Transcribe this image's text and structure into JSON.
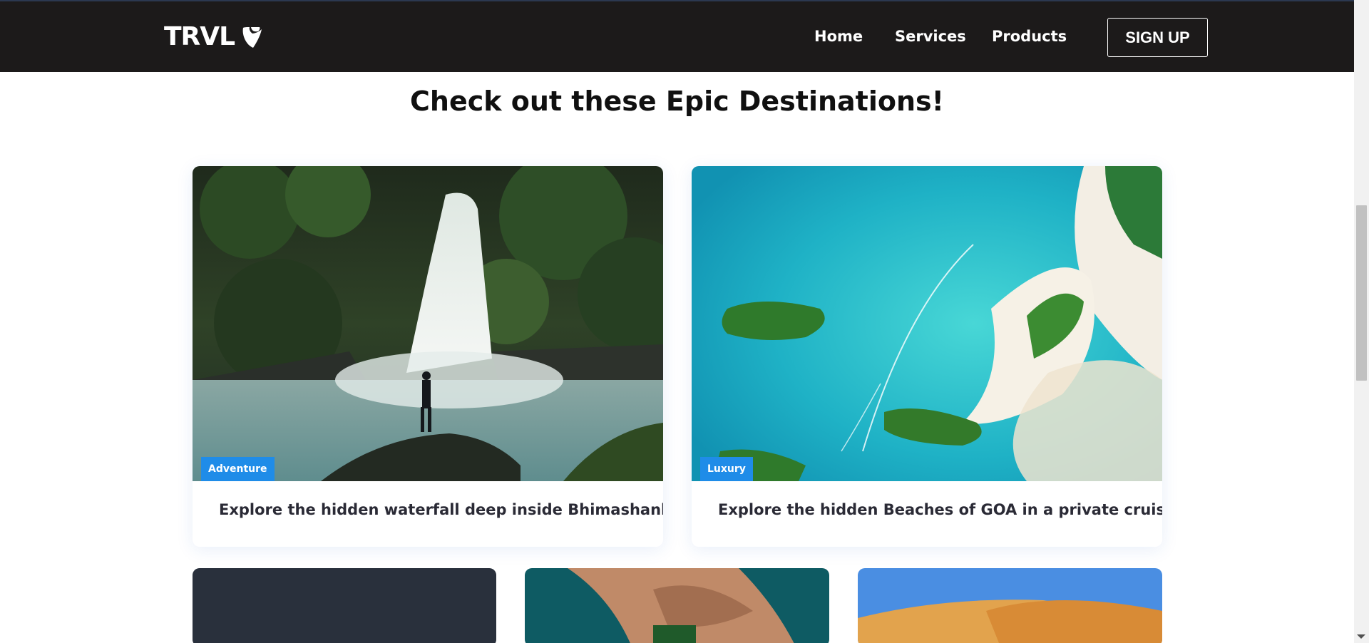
{
  "navbar": {
    "logo_text": "TRVL",
    "links": [
      {
        "label": "Home"
      },
      {
        "label": "Services"
      },
      {
        "label": "Products"
      }
    ],
    "signup_label": "SIGN UP"
  },
  "main": {
    "heading": "Check out these Epic Destinations!",
    "cards": [
      {
        "badge": "Adventure",
        "title": "Explore the hidden waterfall deep inside Bhimashankar",
        "image": "waterfall-image"
      },
      {
        "badge": "Luxury",
        "title": "Explore the hidden Beaches of GOA in a private cruise",
        "image": "beach-aerial-image"
      }
    ],
    "more_cards": [
      {
        "image": "dark-sea-image"
      },
      {
        "image": "island-aerial-image"
      },
      {
        "image": "desert-dunes-image"
      }
    ]
  },
  "colors": {
    "navbar_bg": "#1c1a1a",
    "badge_bg": "#1f8ce8",
    "heading_text": "#101010"
  }
}
